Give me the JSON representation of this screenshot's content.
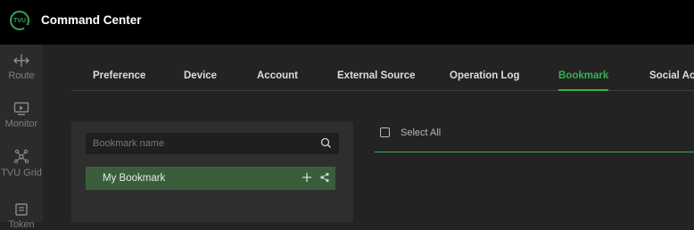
{
  "header": {
    "logo_text": "TVU",
    "app_title": "Command Center"
  },
  "sidebar": {
    "items": [
      {
        "label": "Route",
        "icon": "route-icon"
      },
      {
        "label": "Monitor",
        "icon": "monitor-icon"
      },
      {
        "label": "TVU Grid",
        "icon": "grid-icon"
      },
      {
        "label": "Token",
        "icon": "token-icon"
      }
    ]
  },
  "tabs": [
    {
      "label": "Preference",
      "active": false
    },
    {
      "label": "Device",
      "active": false
    },
    {
      "label": "Account",
      "active": false
    },
    {
      "label": "External Source",
      "active": false
    },
    {
      "label": "Operation Log",
      "active": false
    },
    {
      "label": "Bookmark",
      "active": true
    },
    {
      "label": "Social Acc",
      "active": false
    }
  ],
  "bookmark_panel": {
    "search_placeholder": "Bookmark name",
    "items": [
      {
        "label": "My Bookmark"
      }
    ]
  },
  "right_panel": {
    "select_all_label": "Select All"
  },
  "colors": {
    "accent": "#33b24c",
    "selected_row": "#3a5e3c",
    "header_bg": "#000000"
  }
}
